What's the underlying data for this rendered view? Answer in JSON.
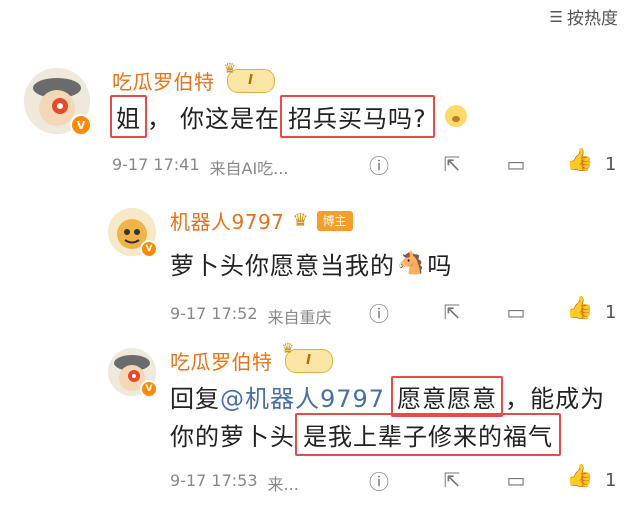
{
  "sort": {
    "icon": "sort-icon",
    "label": "按热度"
  },
  "comments": [
    {
      "user": "吃瓜罗伯特",
      "level_badge": "I",
      "text_parts": [
        "姐",
        "，",
        "你这是在",
        "招兵买马吗?"
      ],
      "time": "9-17 17:41",
      "source": "来自AI吃...",
      "likes": "1"
    },
    {
      "user": "机器人9797",
      "role_badge": "博主",
      "text_parts": [
        "萝卜头你愿意当我的",
        "吗"
      ],
      "emoji": "horse-emoji",
      "time": "9-17 17:52",
      "source": "来自重庆",
      "likes": "1"
    },
    {
      "user": "吃瓜罗伯特",
      "level_badge": "I",
      "reply_prefix": "回复",
      "mention": "@机器人9797",
      "text_parts": [
        "愿意愿意",
        "，能成为",
        "你的萝卜头",
        "是我上辈子修来的福气"
      ],
      "time": "9-17 17:53",
      "source": "来...",
      "likes": "1"
    }
  ],
  "colors": {
    "username": "#e8731a",
    "highlight": "#e74c4c",
    "mention": "#4a6fa5",
    "like": "#ff7f2a"
  }
}
